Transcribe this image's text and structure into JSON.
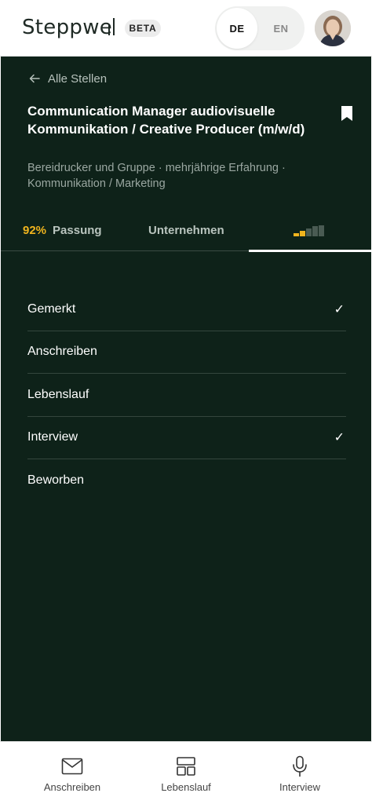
{
  "header": {
    "logo_text": "Steppwe",
    "badge": "BETA",
    "languages": [
      {
        "code": "DE",
        "active": true
      },
      {
        "code": "EN",
        "active": false
      }
    ]
  },
  "job": {
    "back_label": "Alle Stellen",
    "title": "Communication Manager audiovisuelle Kommunikation / Creative Producer (m/w/d)",
    "meta": "Bereidrucker und Gruppe · mehrjährige Erfahrung · Kommunikation / Marketing"
  },
  "tabs": {
    "fit_percent": "92%",
    "fit_label": "Passung",
    "company_label": "Unternehmen",
    "status_progress": {
      "filled": 2,
      "total": 5
    }
  },
  "checklist": [
    {
      "label": "Gemerkt",
      "checked": true
    },
    {
      "label": "Anschreiben",
      "checked": false
    },
    {
      "label": "Lebenslauf",
      "checked": false
    },
    {
      "label": "Interview",
      "checked": true
    },
    {
      "label": "Beworben",
      "checked": false
    }
  ],
  "bottom_nav": [
    {
      "label": "Anschreiben",
      "icon": "envelope-icon"
    },
    {
      "label": "Lebenslauf",
      "icon": "layout-icon"
    },
    {
      "label": "Interview",
      "icon": "microphone-icon"
    }
  ],
  "colors": {
    "panel_bg": "#0e2219",
    "accent_yellow": "#f0b41e",
    "muted_text": "#9aa7a1"
  }
}
